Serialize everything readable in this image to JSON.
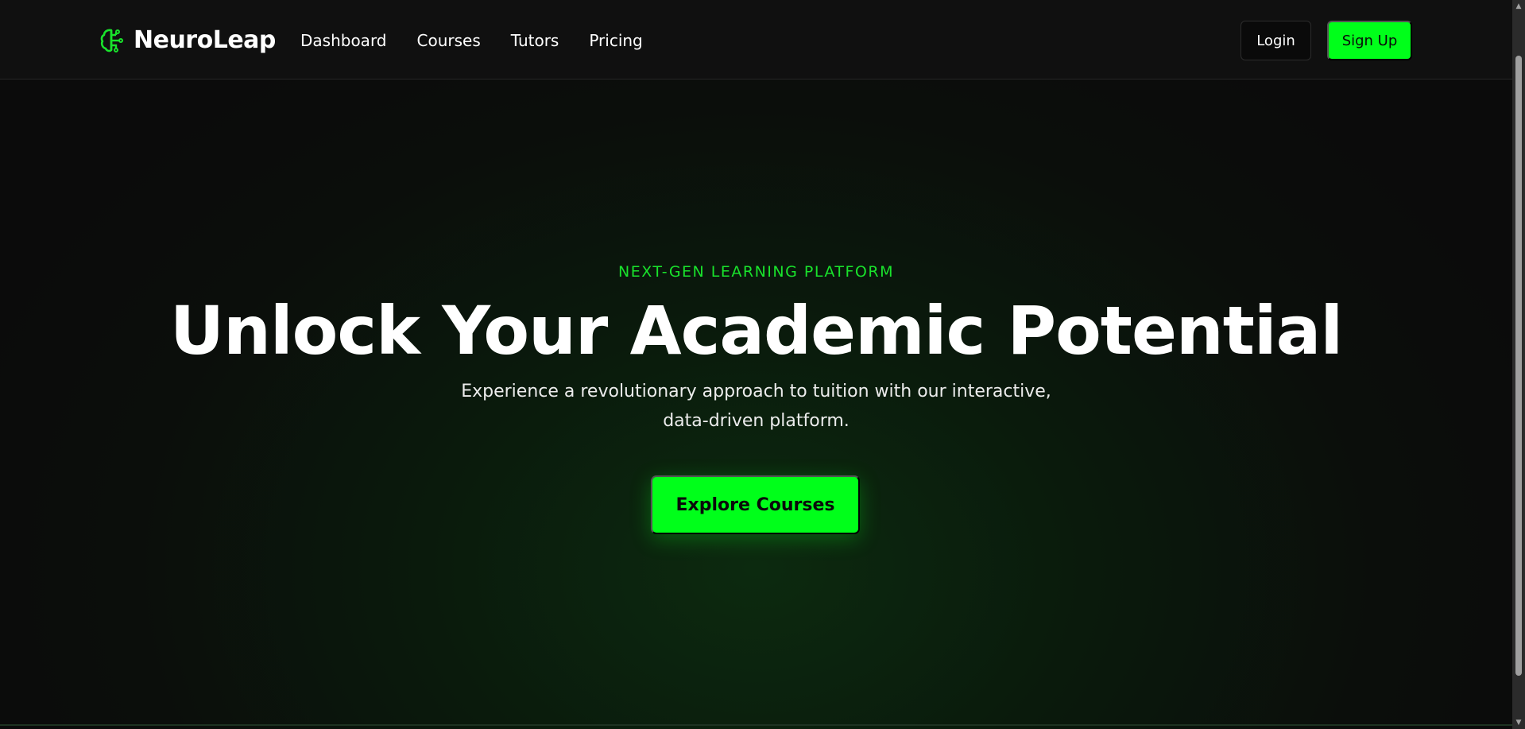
{
  "brand": {
    "name": "NeuroLeap",
    "icon": "brain-icon",
    "accent_color": "#00ff1a"
  },
  "nav": {
    "items": [
      {
        "label": "Dashboard"
      },
      {
        "label": "Courses"
      },
      {
        "label": "Tutors"
      },
      {
        "label": "Pricing"
      }
    ]
  },
  "auth": {
    "login_label": "Login",
    "signup_label": "Sign Up"
  },
  "hero": {
    "eyebrow": "NEXT-GEN LEARNING PLATFORM",
    "title": "Unlock Your Academic Potential",
    "subtitle": "Experience a revolutionary approach to tuition with our interactive, data-driven platform.",
    "cta_label": "Explore Courses"
  },
  "colors": {
    "background": "#0b0b0b",
    "header_bg": "#101010",
    "primary_green": "#00ff1a",
    "eyebrow_green": "#19e32c"
  }
}
